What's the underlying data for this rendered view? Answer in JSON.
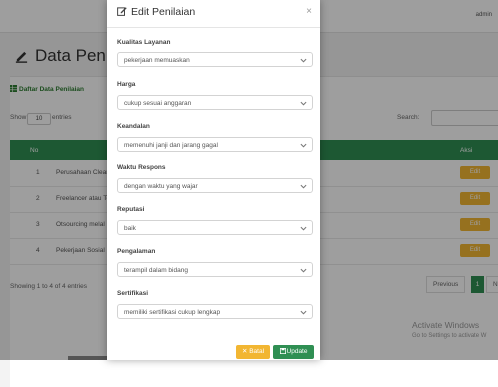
{
  "header": {
    "admin_name": "admin"
  },
  "page": {
    "title": "Data Penilaian"
  },
  "card": {
    "heading": "Daftar Data Penilaian"
  },
  "table_controls": {
    "show_label": "Show",
    "entries_value": "10",
    "entries_label": "entries",
    "search_label": "Search:"
  },
  "table": {
    "headers": {
      "no": "No",
      "aksi": "Aksi"
    },
    "rows": [
      {
        "no": "1",
        "name": "Perusahaan Clean",
        "action": "Edit"
      },
      {
        "no": "2",
        "name": "Freelancer atau Te",
        "action": "Edit"
      },
      {
        "no": "3",
        "name": "Otsourcing melal",
        "action": "Edit"
      },
      {
        "no": "4",
        "name": "Pekerjaan Sosial",
        "action": "Edit"
      }
    ]
  },
  "footer": {
    "showing": "Showing 1 to 4 of 4 entries",
    "previous": "Previous",
    "page": "1",
    "next": "Ne"
  },
  "watermark": {
    "title": "Activate Windows",
    "subtitle": "Go to Settings to activate W"
  },
  "modal": {
    "title": "Edit Penilaian",
    "close": "×",
    "fields": [
      {
        "label": "Kualitas Layanan",
        "value": "pekerjaan memuaskan"
      },
      {
        "label": "Harga",
        "value": "cukup sesuai anggaran"
      },
      {
        "label": "Keandalan",
        "value": "memenuhi janji dan jarang gagal"
      },
      {
        "label": "Waktu Respons",
        "value": "dengan waktu yang wajar"
      },
      {
        "label": "Reputasi",
        "value": "baik"
      },
      {
        "label": "Pengalaman",
        "value": "terampil dalam bidang"
      },
      {
        "label": "Sertifikasi",
        "value": "memiliki sertifikasi cukup lengkap"
      }
    ],
    "buttons": {
      "cancel": "Batal",
      "update": "Update"
    }
  },
  "colors": {
    "primary": "#2f8f53",
    "warning": "#f2b632"
  },
  "icons": [
    "edit-icon",
    "table-icon",
    "chevron-down-icon",
    "close-icon",
    "save-icon"
  ]
}
